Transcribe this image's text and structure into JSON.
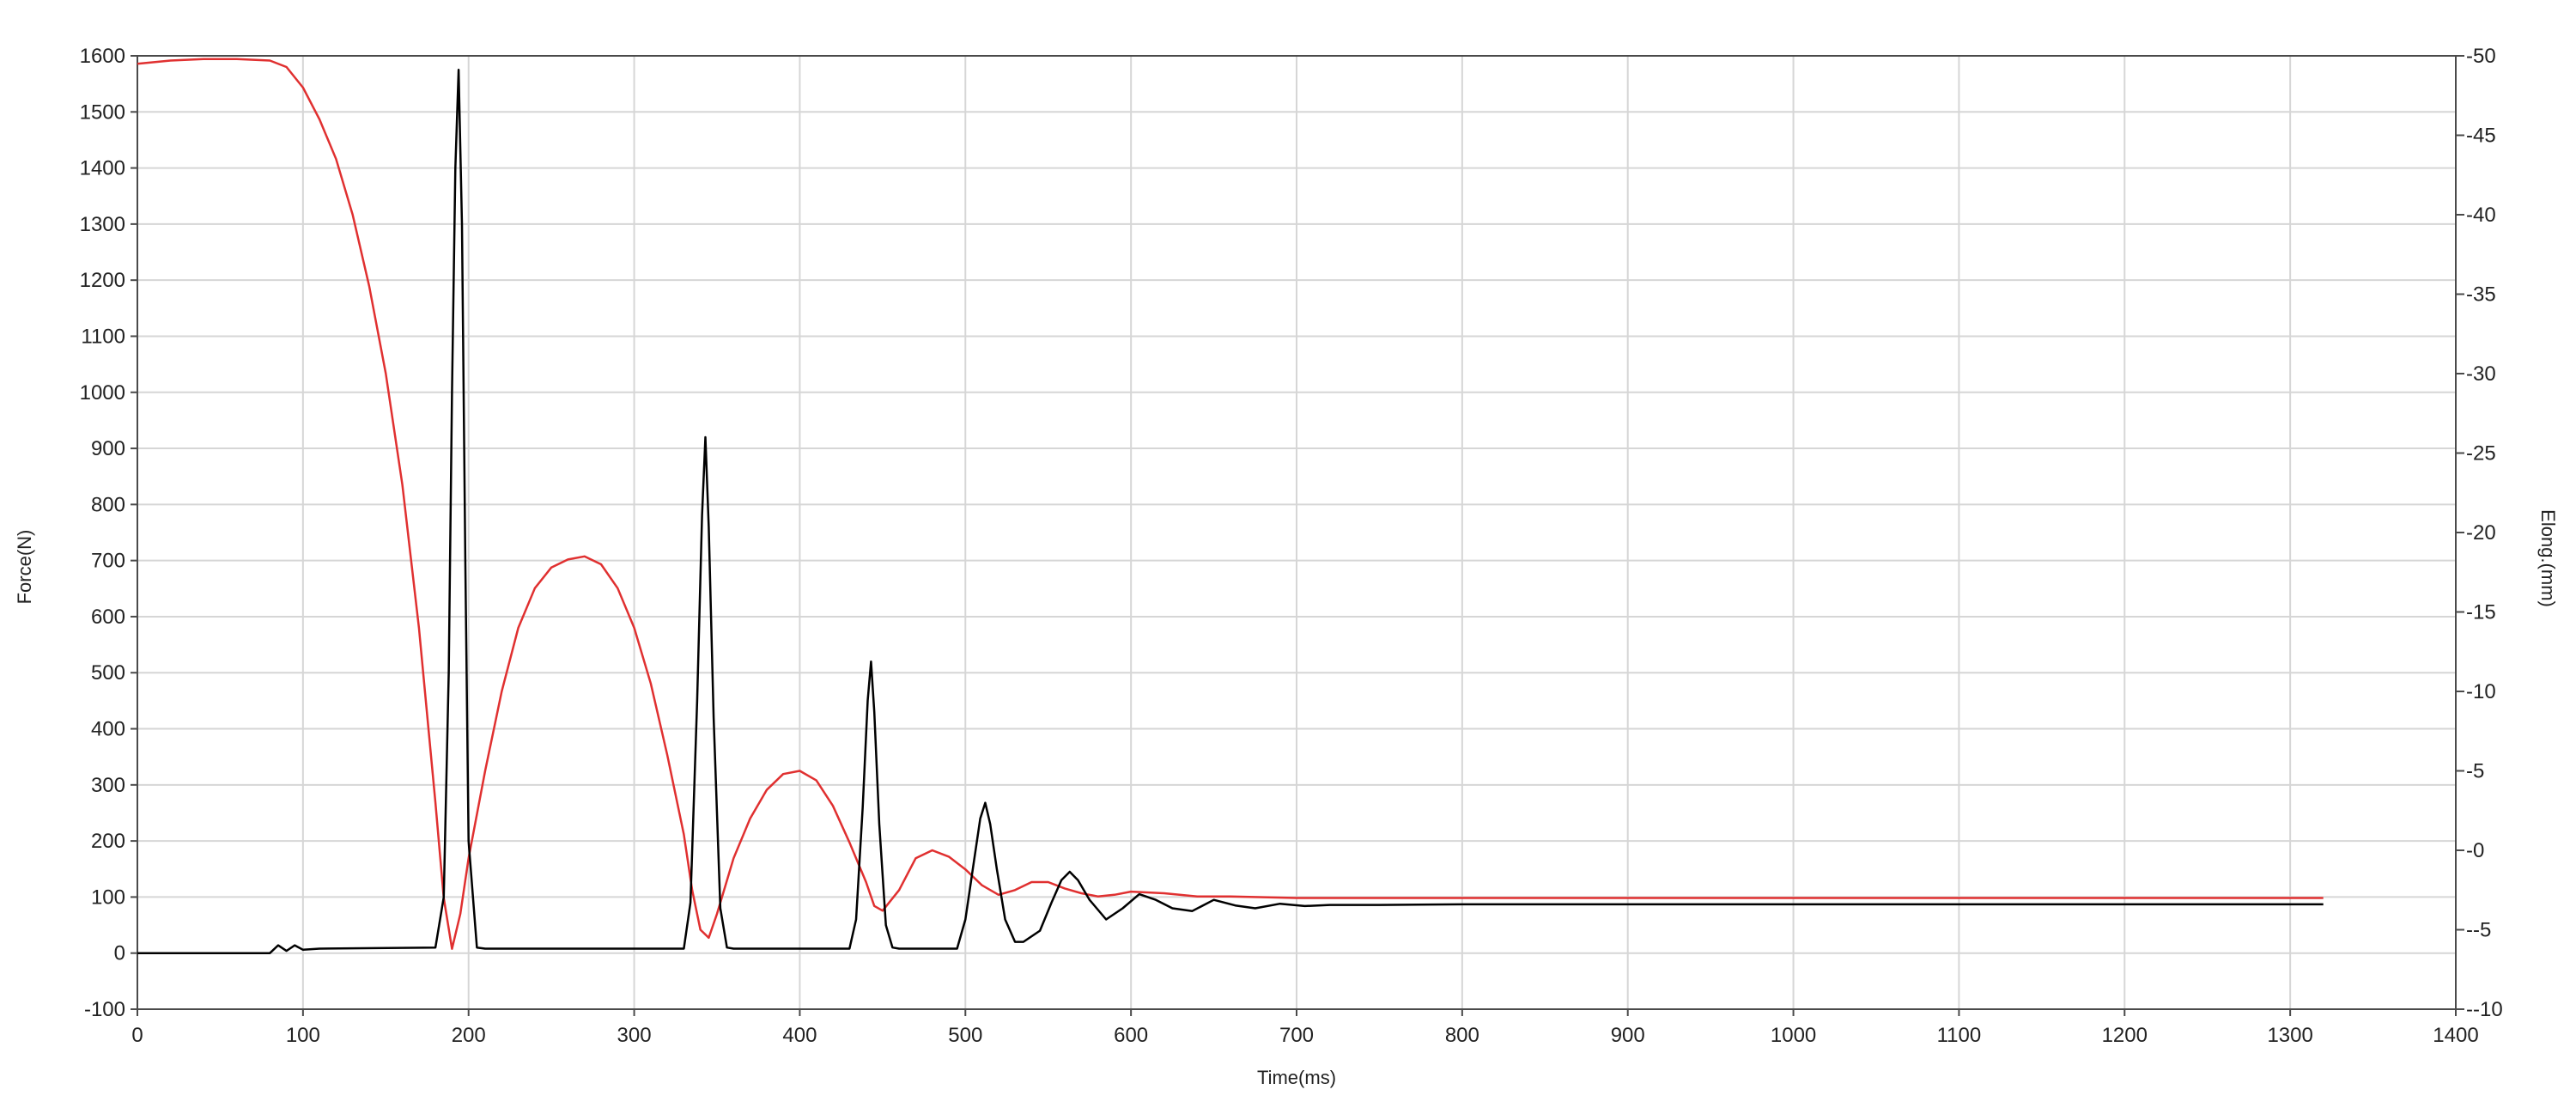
{
  "chart_data": {
    "type": "line",
    "xlabel": "Time(ms)",
    "ylabel_left": "Force(N)",
    "ylabel_right": "Elong.(mm)",
    "xlim": [
      0,
      1400
    ],
    "ylim_left": [
      -100,
      1600
    ],
    "ylim_right": [
      -10,
      50
    ],
    "x_ticks": [
      0,
      100,
      200,
      300,
      400,
      500,
      600,
      700,
      800,
      900,
      1000,
      1100,
      1200,
      1300,
      1400
    ],
    "y_left_ticks": [
      -100,
      0,
      100,
      200,
      300,
      400,
      500,
      600,
      700,
      800,
      900,
      1000,
      1100,
      1200,
      1300,
      1400,
      1500,
      1600
    ],
    "y_right_ticks": [
      -10,
      -5,
      0,
      5,
      10,
      15,
      20,
      25,
      30,
      35,
      40,
      45,
      50
    ],
    "grid": true,
    "series": [
      {
        "axis": "left",
        "color": "#000000",
        "x": [
          0,
          80,
          85,
          90,
          95,
          100,
          110,
          180,
          185,
          188,
          190,
          192,
          194,
          196,
          198,
          200,
          205,
          210,
          330,
          334,
          338,
          341,
          343,
          345,
          348,
          352,
          356,
          360,
          430,
          434,
          438,
          441,
          443,
          445,
          448,
          452,
          456,
          460,
          495,
          500,
          505,
          509,
          512,
          515,
          519,
          524,
          530,
          535,
          545,
          552,
          558,
          563,
          568,
          575,
          585,
          595,
          605,
          615,
          625,
          637,
          650,
          663,
          675,
          690,
          705,
          720,
          750,
          800,
          900,
          1000,
          1100,
          1200,
          1320
        ],
        "y": [
          0,
          0,
          14,
          4,
          14,
          6,
          8,
          10,
          100,
          500,
          1000,
          1400,
          1575,
          1300,
          700,
          200,
          10,
          8,
          8,
          90,
          450,
          780,
          920,
          760,
          420,
          80,
          10,
          8,
          8,
          60,
          260,
          450,
          520,
          430,
          230,
          50,
          10,
          8,
          8,
          60,
          160,
          240,
          268,
          230,
          150,
          60,
          20,
          20,
          40,
          90,
          130,
          145,
          130,
          95,
          60,
          80,
          105,
          95,
          80,
          75,
          95,
          85,
          80,
          88,
          84,
          86,
          86,
          87,
          87,
          87,
          87,
          87,
          87
        ]
      },
      {
        "axis": "right",
        "color": "#e03030",
        "x": [
          0,
          20,
          40,
          60,
          80,
          90,
          100,
          110,
          120,
          130,
          140,
          150,
          160,
          170,
          180,
          185,
          190,
          195,
          200,
          210,
          220,
          230,
          240,
          250,
          260,
          270,
          280,
          290,
          300,
          310,
          320,
          330,
          335,
          340,
          345,
          350,
          360,
          370,
          380,
          390,
          400,
          410,
          420,
          430,
          440,
          445,
          450,
          460,
          470,
          480,
          490,
          500,
          510,
          520,
          530,
          540,
          550,
          560,
          570,
          580,
          590,
          600,
          620,
          640,
          660,
          700,
          800,
          900,
          1000,
          1100,
          1200,
          1320
        ],
        "y": [
          49.5,
          49.7,
          49.8,
          49.8,
          49.7,
          49.3,
          48.0,
          46.0,
          43.5,
          40.0,
          35.5,
          30.0,
          23.0,
          14.0,
          3.0,
          -3.0,
          -6.2,
          -4.0,
          -0.5,
          5.0,
          10.0,
          14.0,
          16.5,
          17.8,
          18.3,
          18.5,
          18.0,
          16.5,
          14.0,
          10.5,
          6.0,
          1.0,
          -2.5,
          -5.0,
          -5.5,
          -4.0,
          -0.5,
          2.0,
          3.8,
          4.8,
          5.0,
          4.4,
          2.8,
          0.5,
          -2.0,
          -3.5,
          -3.8,
          -2.5,
          -0.5,
          0.0,
          -0.4,
          -1.2,
          -2.2,
          -2.8,
          -2.5,
          -2.0,
          -2.0,
          -2.4,
          -2.7,
          -2.9,
          -2.8,
          -2.6,
          -2.7,
          -2.9,
          -2.9,
          -3.0,
          -3.0,
          -3.0,
          -3.0,
          -3.0,
          -3.0,
          -3.0
        ]
      }
    ]
  }
}
